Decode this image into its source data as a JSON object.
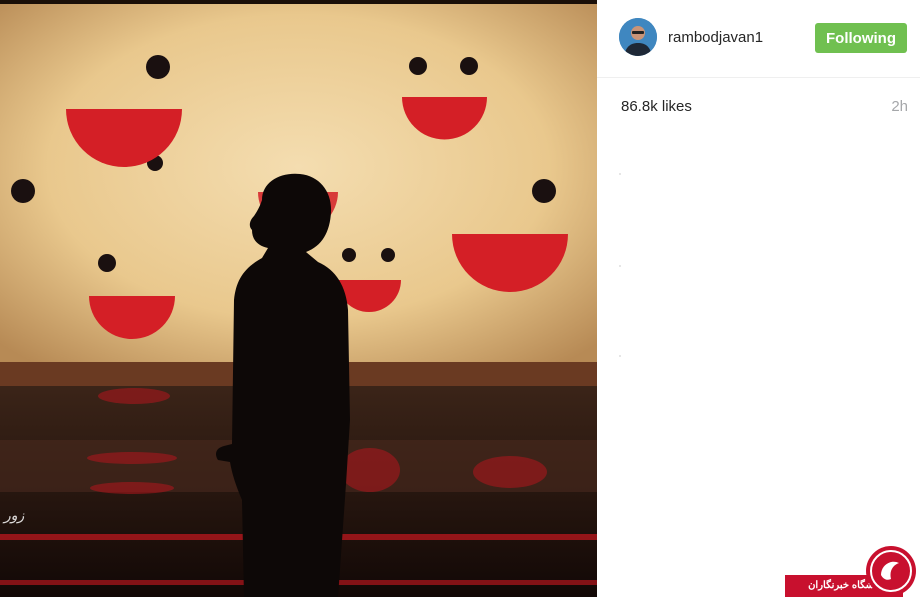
{
  "post": {
    "username": "rambodjavan1",
    "follow_label": "Following",
    "likes": "86.8k likes",
    "time": "2h"
  },
  "watermark": {
    "text": "باشگاه خبرنگاران"
  },
  "colors": {
    "follow_button": "#70c050",
    "smile_red": "#d41f26",
    "backdrop": "#eccf9a",
    "watermark_red": "#c8102e"
  }
}
